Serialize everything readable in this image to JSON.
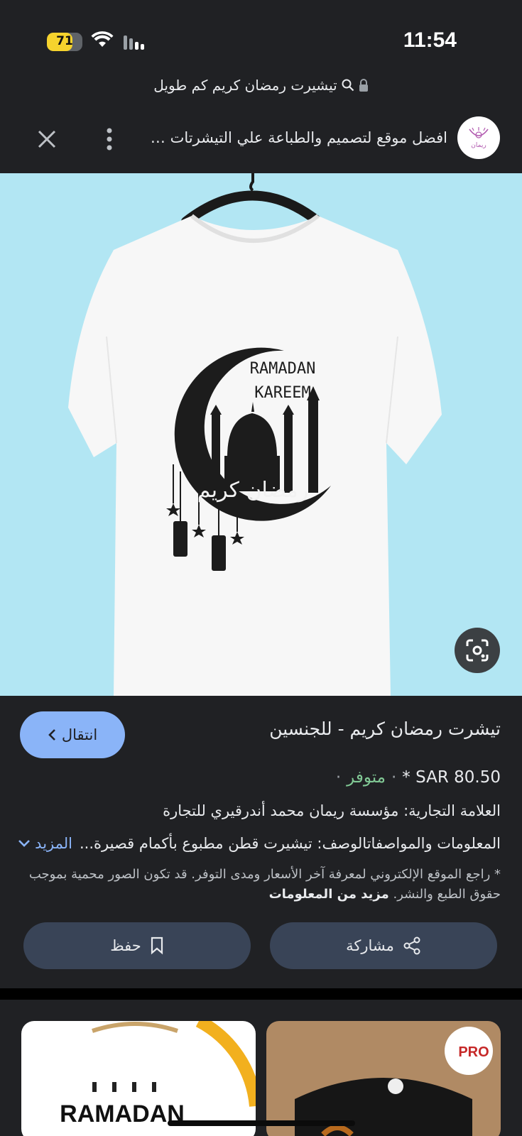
{
  "status_bar": {
    "battery_percent": "71",
    "time": "11:54"
  },
  "url_bar": {
    "query": "تيشيرت رمضان كريم كم طويل"
  },
  "header": {
    "site_title": "افضل موقع لتصميم والطباعة علي التيشرتات والهدايا",
    "logo_text": "ريمان"
  },
  "product_image": {
    "print_line1": "RAMADAN",
    "print_line2": "KAREEM",
    "print_arabic": "رمضان كريم"
  },
  "product": {
    "title": "تيشرت رمضان كريم - للجنسين",
    "price": "SAR 80.50 *",
    "availability": "متوفر",
    "brand": "العلامة التجارية: مؤسسة ريمان محمد أندرقيري للتجارة",
    "specs": "المعلومات والمواصفاتالوصف: تيشيرت قطن مطبوع بأكمام قصيرة...",
    "more_label": "المزيد",
    "disclaimer": "* راجع الموقع الإلكتروني لمعرفة آخر الأسعار ومدى التوفر. قد تكون الصور محمية بموجب حقوق الطبع والنشر.",
    "more_info_label": "مزيد من المعلومات"
  },
  "buttons": {
    "go": "انتقال",
    "share": "مشاركة",
    "save": "حفظ"
  },
  "related": {
    "thumb1_text": "RAMADAN",
    "thumb2_logo": "PRO"
  },
  "colors": {
    "background": "#202124",
    "accent": "#8ab4f8",
    "available": "#81c995",
    "image_bg": "#b2e6f3"
  }
}
